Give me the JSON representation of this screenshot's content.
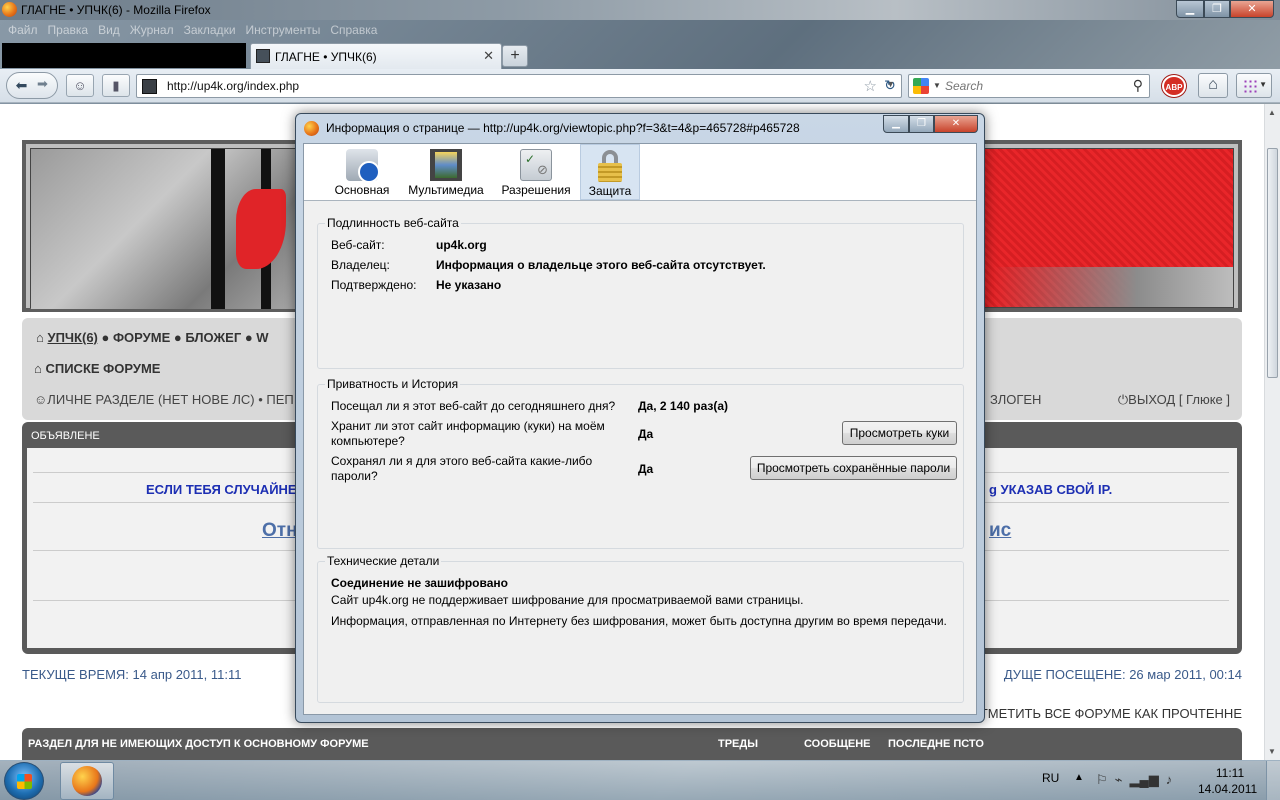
{
  "window": {
    "title": "ГЛАГНЕ • УПЧК(6) - Mozilla Firefox"
  },
  "menubar": [
    "Файл",
    "Правка",
    "Вид",
    "Журнал",
    "Закладки",
    "Инструменты",
    "Справка"
  ],
  "tabs": {
    "active_label": "ГЛАГНЕ • УПЧК(6)",
    "close_glyph": "✕",
    "new_tab_glyph": "+"
  },
  "navbar": {
    "url": "http://up4k.org/index.php",
    "search_placeholder": "Search",
    "abp_label": "ABP"
  },
  "page": {
    "nav_row1_link": "УПЧК(6)",
    "nav_row1_rest": "● ФОРУМЕ ● БЛОЖЕГ ● W",
    "nav_row2": "СПИСКЕ ФОРУМЕ",
    "nav_row3_left": "ЛИЧНЕ РАЗДЕЛЕ (НЕТ НОВЕ ЛС) • ПЕП",
    "nav_row3_right": "ЗЛОГЕН",
    "nav_logout": "ВЫХОД [ Глюке ]",
    "announce_header": "ОБЪЯВЛЕНЕ",
    "announce_line_left": "ЕСЛИ ТЕБЯ СЛУЧАЙНЕ",
    "announce_line_right": "g УКАЗАВ СВОЙ IP.",
    "announce_big_left": "Отн",
    "announce_big_right": "ис",
    "time_left": "ТЕКУЩЕ ВРЕМЯ: 14 апр 2011, 11:11",
    "time_right": "ДУЩЕ ПОСЕЩЕНЕ: 26 мар 2011, 00:14",
    "mark_all": "ОТМЕТИТЬ ВСЕ ФОРУМЕ КАК ПРОЧТЕННЕ",
    "table_headers": {
      "section": "РАЗДЕЛ ДЛЯ НЕ ИМЕЮЩИХ ДОСТУП К ОСНОВНОМУ ФОРУМЕ",
      "topics": "ТРЕДЫ",
      "posts": "СООБЩЕНЕ",
      "last_post": "ПОСЛЕДНЕ ПСТО"
    }
  },
  "dialog": {
    "title": "Информация о странице — http://up4k.org/viewtopic.php?f=3&t=4&p=465728#p465728",
    "tabs": [
      {
        "label": "Основная",
        "icon": "info-icon"
      },
      {
        "label": "Мультимедиа",
        "icon": "media-icon"
      },
      {
        "label": "Разрешения",
        "icon": "permissions-icon"
      },
      {
        "label": "Защита",
        "icon": "lock-icon"
      }
    ],
    "identity": {
      "caption": "Подлинность веб-сайта",
      "website_label": "Веб-сайт:",
      "website_value": "up4k.org",
      "owner_label": "Владелец:",
      "owner_value": "Информация о владельце этого веб-сайта отсутствует.",
      "verified_label": "Подтверждено:",
      "verified_value": "Не указано"
    },
    "privacy": {
      "caption": "Приватность и История",
      "visited_label": "Посещал ли я этот веб-сайт до сегодняшнего дня?",
      "visited_value": "Да, 2 140 раз(а)",
      "cookies_label_1": "Хранит ли этот сайт информацию (куки) на моём",
      "cookies_label_2": "компьютере?",
      "cookies_value": "Да",
      "cookies_button": "Просмотреть куки",
      "passwords_label_1": "Сохранял ли я для этого веб-сайта какие-либо",
      "passwords_label_2": "пароли?",
      "passwords_value": "Да",
      "passwords_button": "Просмотреть сохранённые пароли"
    },
    "technical": {
      "caption": "Технические детали",
      "heading": "Соединение не зашифровано",
      "line1": "Сайт up4k.org не поддерживает шифрование для просматриваемой вами страницы.",
      "line2": "Информация, отправленная по Интернету без шифрования, может быть доступна другим во время передачи."
    }
  },
  "taskbar": {
    "language": "RU",
    "time": "11:11",
    "date": "14.04.2011"
  }
}
